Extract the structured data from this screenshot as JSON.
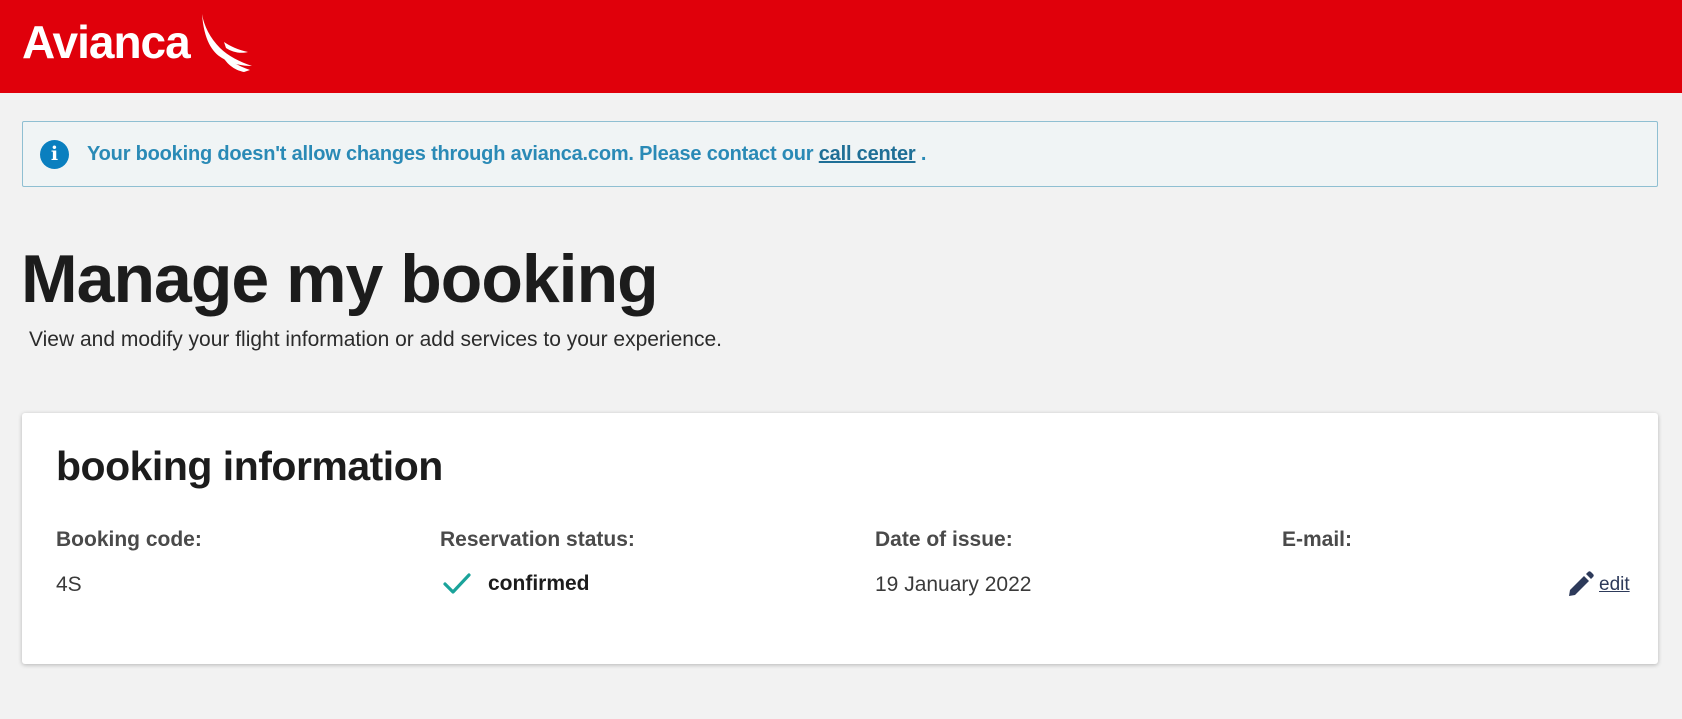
{
  "header": {
    "logo_text": "Avianca",
    "brand_color": "#e0000b"
  },
  "notice": {
    "icon": "info-icon",
    "text_before": "Your booking doesn't allow changes through avianca.com. Please contact our ",
    "link_text": "call center",
    "text_after": " ."
  },
  "page": {
    "title": "Manage my booking",
    "subtitle": "View and modify your flight information or add services to your experience."
  },
  "booking_card": {
    "title": "booking information",
    "booking_code": {
      "label": "Booking code:",
      "value": "4S"
    },
    "reservation_status": {
      "label": "Reservation status:",
      "value": "confirmed",
      "icon": "check-icon",
      "icon_color": "#1aa39a"
    },
    "date_of_issue": {
      "label": "Date of issue:",
      "value": "19 January 2022"
    },
    "email": {
      "label": "E-mail:",
      "value": "",
      "edit_label": "edit",
      "edit_icon": "pencil-icon"
    }
  }
}
